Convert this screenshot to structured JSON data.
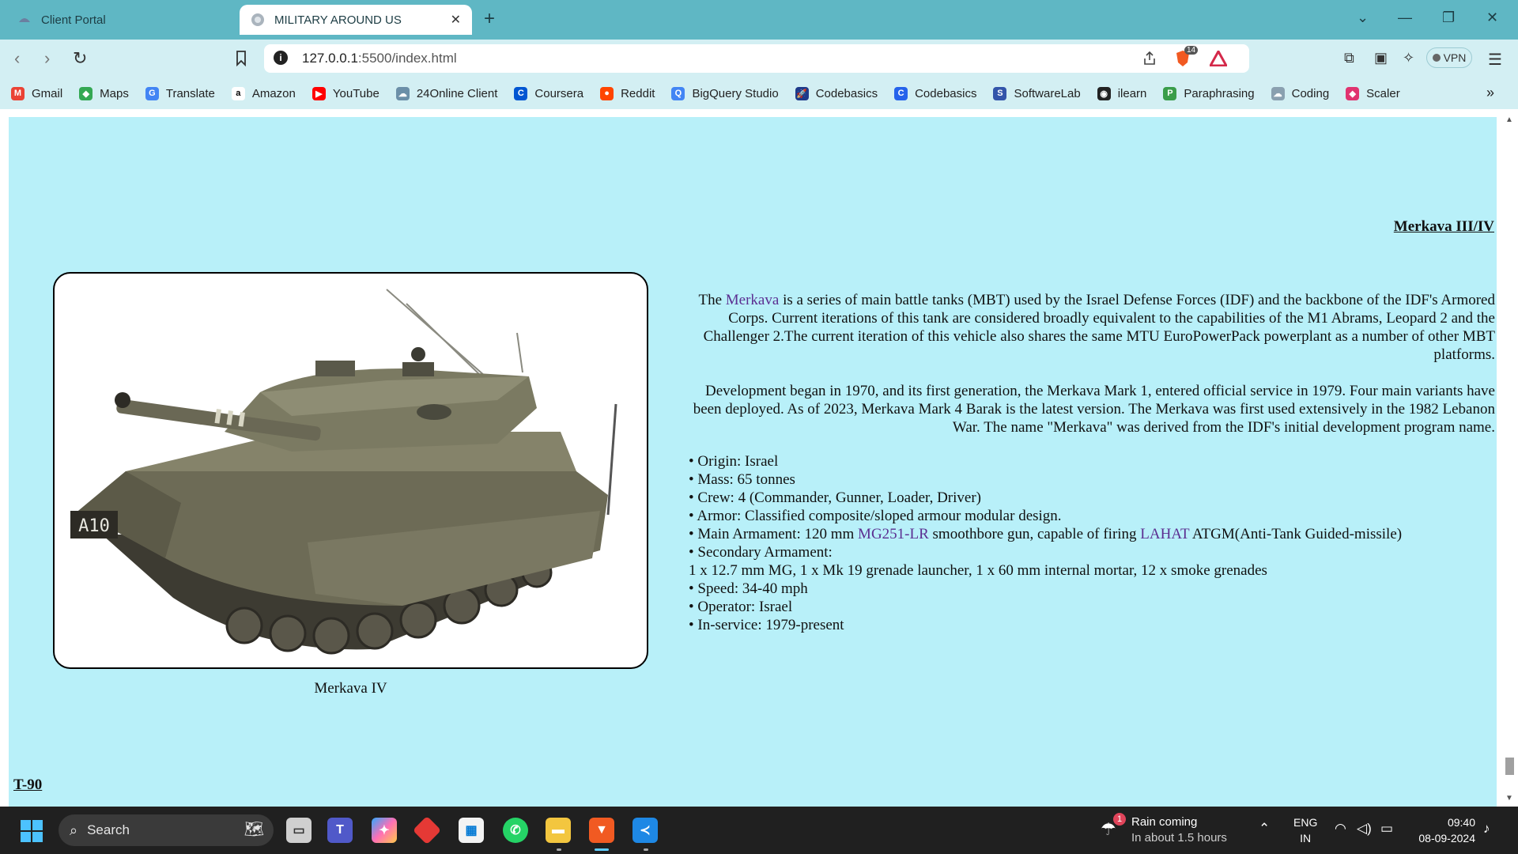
{
  "browser": {
    "tabs": [
      {
        "title": "Client Portal",
        "icon": "cloud-icon",
        "active": false
      },
      {
        "title": "MILITARY AROUND US",
        "icon": "globe-icon",
        "active": true
      }
    ],
    "new_tab": "+",
    "window_controls": {
      "dropdown": "⌄",
      "minimize": "—",
      "restore": "❐",
      "close": "✕"
    },
    "address": {
      "host": "127.0.0.1",
      "rest": ":5500/index.html",
      "info": "i"
    },
    "shield_badge": "14",
    "vpn_label": "VPN",
    "bookmarks": [
      {
        "label": "Gmail",
        "icon": "gmail-icon",
        "color": "#ea4335",
        "glyph": "M"
      },
      {
        "label": "Maps",
        "icon": "maps-icon",
        "color": "#34a853",
        "glyph": "◆"
      },
      {
        "label": "Translate",
        "icon": "translate-icon",
        "color": "#4285f4",
        "glyph": "G"
      },
      {
        "label": "Amazon",
        "icon": "amazon-icon",
        "color": "#ffffff",
        "glyph": "a"
      },
      {
        "label": "YouTube",
        "icon": "youtube-icon",
        "color": "#ff0000",
        "glyph": "▶"
      },
      {
        "label": "24Online Client",
        "icon": "cloud-icon",
        "color": "#6b8fa8",
        "glyph": "☁"
      },
      {
        "label": "Coursera",
        "icon": "coursera-icon",
        "color": "#0056d2",
        "glyph": "C"
      },
      {
        "label": "Reddit",
        "icon": "reddit-icon",
        "color": "#ff4500",
        "glyph": "●"
      },
      {
        "label": "BigQuery Studio",
        "icon": "bigquery-icon",
        "color": "#4285f4",
        "glyph": "Q"
      },
      {
        "label": "Codebasics",
        "icon": "rocket-icon",
        "color": "#1e3a8a",
        "glyph": "🚀"
      },
      {
        "label": "Codebasics",
        "icon": "codebasics-icon",
        "color": "#2563eb",
        "glyph": "C"
      },
      {
        "label": "SoftwareLab",
        "icon": "softwarelab-icon",
        "color": "#3355aa",
        "glyph": "S"
      },
      {
        "label": "ilearn",
        "icon": "ilearn-icon",
        "color": "#222222",
        "glyph": "◉"
      },
      {
        "label": "Paraphrasing",
        "icon": "paraphrasing-icon",
        "color": "#3a9d4a",
        "glyph": "P"
      },
      {
        "label": "Coding",
        "icon": "coding-icon",
        "color": "#8aa0b0",
        "glyph": "☁"
      },
      {
        "label": "Scaler",
        "icon": "scaler-icon",
        "color": "#e0336f",
        "glyph": "◆"
      }
    ],
    "bookmarks_more": "»"
  },
  "page": {
    "section_title": "Merkava III/IV",
    "figure": {
      "caption": "Merkava IV",
      "image": "tank-photo",
      "hull_marking": "A10"
    },
    "description": {
      "p1_pre": "The ",
      "p1_link": "Merkava",
      "p1_post": " is a series of main battle tanks (MBT) used by the Israel Defense Forces (IDF) and the backbone of the IDF's Armored Corps. Current iterations of this tank are considered broadly equivalent to the capabilities of the M1 Abrams, Leopard 2 and the Challenger 2.The current iteration of this vehicle also shares the same MTU EuroPowerPack powerplant as a number of other MBT platforms.",
      "p2": "Development began in 1970, and its first generation, the Merkava Mark 1, entered official service in 1979. Four main variants have been deployed. As of 2023, Merkava Mark 4 Barak is the latest version. The Merkava was first used extensively in the 1982 Lebanon War. The name \"Merkava\" was derived from the IDF's initial development program name."
    },
    "specs": {
      "origin": "• Origin: Israel",
      "mass": "• Mass: 65 tonnes",
      "crew": "• Crew: 4 (Commander, Gunner, Loader, Driver)",
      "armor": "• Armor: Classified composite/sloped armour modular design.",
      "main_pre": "• Main Armament: 120 mm ",
      "main_link1": "MG251-LR",
      "main_mid": " smoothbore gun, capable of firing ",
      "main_link2": "LAHAT",
      "main_post": " ATGM(Anti-Tank Guided-missile)",
      "secondary_label": "• Secondary Armament:",
      "secondary_value": "1 x 12.7 mm MG, 1 x Mk 19 grenade launcher, 1 x 60 mm internal mortar, 12 x smoke grenades",
      "speed": "• Speed: 34-40 mph",
      "operator": "• Operator: Israel",
      "in_service": "• In-service: 1979-present"
    },
    "next_section_title": "T-90",
    "background_color": "#b8f0f9",
    "link_color": "#5b2e91"
  },
  "taskbar": {
    "search_placeholder": "Search",
    "apps": [
      "file-explorer-icon",
      "teams-icon",
      "copilot-icon",
      "git-icon",
      "store-icon",
      "whatsapp-icon",
      "folder-icon",
      "brave-icon",
      "vscode-icon"
    ],
    "weather": {
      "title": "Rain coming",
      "subtitle": "In about 1.5 hours",
      "badge": "1"
    },
    "language": {
      "line1": "ENG",
      "line2": "IN"
    },
    "clock": {
      "time": "09:40",
      "date": "08-09-2024"
    }
  }
}
